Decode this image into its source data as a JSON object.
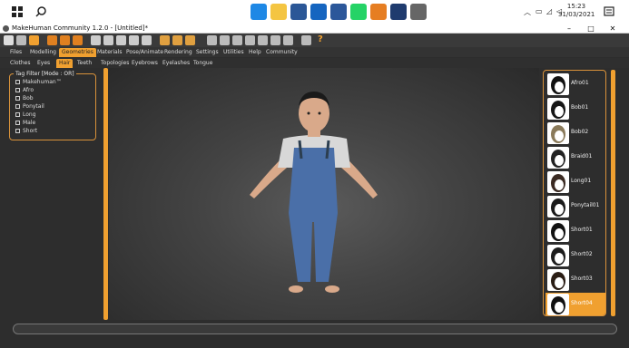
{
  "taskbar": {
    "search_icon": "search-icon",
    "time": "15:23",
    "date": "31/03/2021",
    "tray_icons": [
      "chevron-up-icon",
      "battery-icon",
      "wifi-icon",
      "volume-icon"
    ],
    "apps": [
      {
        "name": "edge",
        "color": "#1e88e5"
      },
      {
        "name": "file-explorer",
        "color": "#f4c542"
      },
      {
        "name": "mail",
        "color": "#2b5797"
      },
      {
        "name": "dropbox",
        "color": "#1565c0"
      },
      {
        "name": "word",
        "color": "#2b579a"
      },
      {
        "name": "whatsapp",
        "color": "#25d366"
      },
      {
        "name": "app-orange",
        "color": "#e67e22"
      },
      {
        "name": "screen",
        "color": "#1f3b6e"
      },
      {
        "name": "steam-like",
        "color": "#666666"
      }
    ]
  },
  "window": {
    "title": "MakeHuman Community 1.2.0 - [Untitled]*",
    "minimize": "–",
    "maximize": "□",
    "close": "✕"
  },
  "toolbar": {
    "help_glyph": "?"
  },
  "main_tabs": [
    {
      "label": "Files",
      "active": false
    },
    {
      "label": "Modelling",
      "active": false
    },
    {
      "label": "Geometries",
      "active": true
    },
    {
      "label": "Materials",
      "active": false
    },
    {
      "label": "Pose/Animate",
      "active": false
    },
    {
      "label": "Rendering",
      "active": false
    },
    {
      "label": "Settings",
      "active": false
    },
    {
      "label": "Utilities",
      "active": false
    },
    {
      "label": "Help",
      "active": false
    },
    {
      "label": "Community",
      "active": false
    }
  ],
  "sub_tabs": [
    {
      "label": "Clothes",
      "active": false
    },
    {
      "label": "Eyes",
      "active": false
    },
    {
      "label": "Hair",
      "active": true
    },
    {
      "label": "Teeth",
      "active": false
    },
    {
      "label": "Topologies",
      "active": false
    },
    {
      "label": "Eyebrows",
      "active": false
    },
    {
      "label": "Eyelashes",
      "active": false
    },
    {
      "label": "Tongue",
      "active": false
    }
  ],
  "tag_filter": {
    "legend": "Tag Filter [Mode : OR]",
    "items": [
      "Makehuman™",
      "Afro",
      "Bob",
      "Ponytail",
      "Long",
      "Male",
      "Short"
    ]
  },
  "hair_list": {
    "items": [
      {
        "label": "Afro01",
        "selected": false,
        "hair_color": "#111111"
      },
      {
        "label": "Bob01",
        "selected": false,
        "hair_color": "#151515"
      },
      {
        "label": "Bob02",
        "selected": false,
        "hair_color": "#8a7a5a"
      },
      {
        "label": "Braid01",
        "selected": false,
        "hair_color": "#222222"
      },
      {
        "label": "Long01",
        "selected": false,
        "hair_color": "#3a2a22"
      },
      {
        "label": "Ponytail01",
        "selected": false,
        "hair_color": "#1a1a1a"
      },
      {
        "label": "Short01",
        "selected": false,
        "hair_color": "#111111"
      },
      {
        "label": "Short02",
        "selected": false,
        "hair_color": "#1c1c1c"
      },
      {
        "label": "Short03",
        "selected": false,
        "hair_color": "#2a1d14"
      },
      {
        "label": "Short04",
        "selected": true,
        "hair_color": "#111111"
      }
    ]
  },
  "colors": {
    "accent": "#f0a030",
    "panel_bg": "#2d2d2d",
    "denim": "#4a6fa8",
    "skin": "#d9a98a",
    "shirt": "#d8d8d8"
  }
}
